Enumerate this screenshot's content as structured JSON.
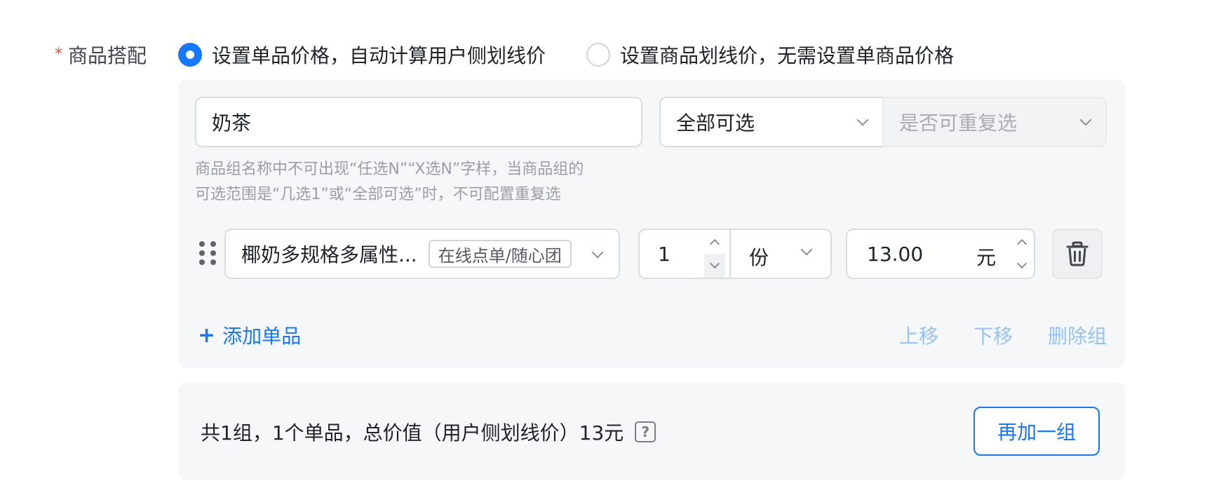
{
  "field": {
    "required_mark": "*",
    "label": "商品搭配"
  },
  "mode_options": [
    {
      "label": "设置单品价格，自动计算用户侧划线价",
      "checked": true
    },
    {
      "label": "设置商品划线价，无需设置单商品价格",
      "checked": false
    }
  ],
  "group": {
    "name_value": "奶茶",
    "select_mode": "全部可选",
    "repeat_placeholder": "是否可重复选",
    "hint_lines": [
      "商品组名称中不可出现“任选N”“X选N”字样，当商品组的",
      "可选范围是“几选1”或“全部可选”时，不可配置重复选"
    ],
    "item": {
      "product_name": "椰奶多规格多属性...",
      "product_tag": "在线点单/随心团",
      "quantity": "1",
      "quantity_unit": "份",
      "price": "13.00",
      "price_unit": "元"
    },
    "add_item_label": "添加单品",
    "add_item_icon": "+",
    "move_up_label": "上移",
    "move_down_label": "下移",
    "delete_group_label": "删除组"
  },
  "summary": {
    "text": "共1组，1个单品，总价值（用户侧划线价）13元",
    "help_icon": "?",
    "add_group_label": "再加一组"
  },
  "colors": {
    "accent": "#1677ff",
    "accent_light": "#94c2fb",
    "required": "#f5483b",
    "panel_bg": "#f6f7f9"
  }
}
